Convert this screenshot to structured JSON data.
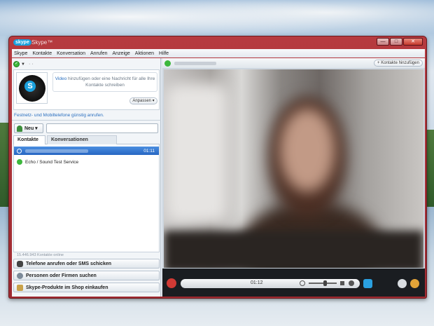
{
  "window": {
    "logo": "skype",
    "title": "Skype™"
  },
  "menu": [
    "Skype",
    "Kontakte",
    "Konversation",
    "Anrufen",
    "Anzeige",
    "Aktionen",
    "Hilfe"
  ],
  "profile": {
    "mood_link": "Video",
    "mood_text": " hinzufügen oder eine Nachricht für alle Ihre Kontakte schreiben",
    "customize_label": "Anpassen ▾",
    "promo": "Festnetz- und Mobiltelefone günstig anrufen."
  },
  "toolbar": {
    "new_label": "Neu ▾",
    "search_placeholder": ""
  },
  "tabs": [
    "Kontakte",
    "Konversationen"
  ],
  "contacts": [
    {
      "time": "01:11"
    },
    {
      "name": "Echo / Sound Test Service"
    }
  ],
  "online_count": "15.446.943 Kontakte online",
  "actions": [
    "Telefone anrufen oder SMS schicken",
    "Personen oder Firmen suchen",
    "Skype-Produkte im Shop einkaufen"
  ],
  "call": {
    "add_contact_label": "+ Kontakte hinzufügen",
    "timer": "01:12"
  },
  "colors": {
    "frame": "#b63a3f",
    "skype_blue": "#1aa0dd",
    "hangup": "#d03a35",
    "selection": "#2766c2"
  }
}
